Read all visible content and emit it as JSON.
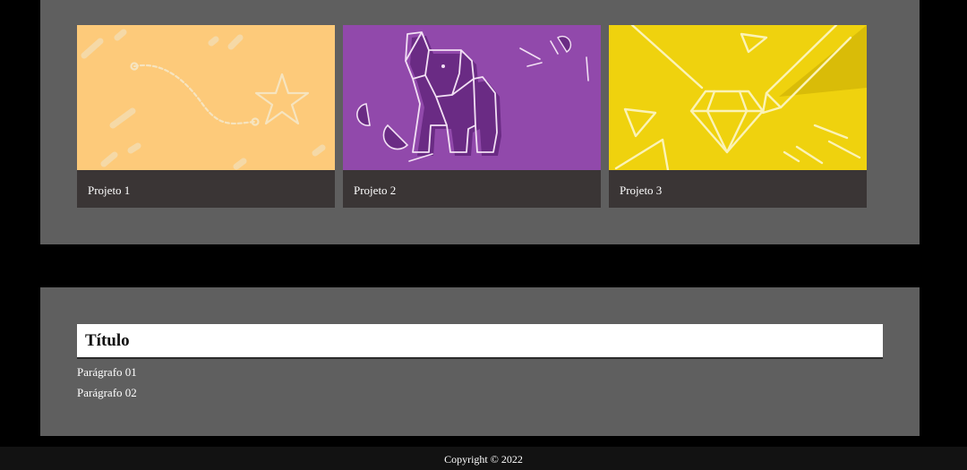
{
  "projects": [
    {
      "label": "Projeto 1",
      "image_icon": "bezier-path-star-illustration",
      "color": "#fdca7a"
    },
    {
      "label": "Projeto 2",
      "image_icon": "origami-elephant-illustration",
      "color": "#9149ab"
    },
    {
      "label": "Projeto 3",
      "image_icon": "diamond-pencil-illustration",
      "color": "#efd20e"
    }
  ],
  "content": {
    "title": "Título",
    "paragraphs": [
      "Parágrafo 01",
      "Parágrafo 02"
    ]
  },
  "footer": {
    "copyright": "Copyright © 2022"
  },
  "colors": {
    "page_background": "#000000",
    "section_background": "#5f5f5f",
    "card_caption_background": "#3a3535",
    "footer_background": "#121212"
  }
}
